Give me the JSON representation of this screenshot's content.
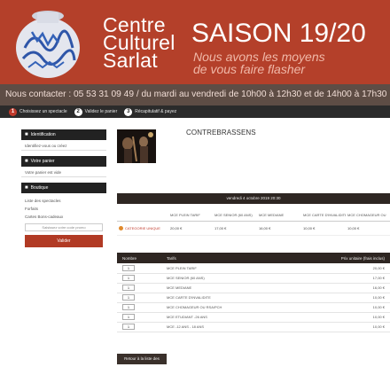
{
  "banner": {
    "brand_line1": "Centre",
    "brand_line2": "Culturel",
    "brand_line3": "Sarlat",
    "season": "SAISON 19/20",
    "tagline_line1": "Nous avons les moyens",
    "tagline_line2": "de vous faire flasher",
    "contact": "Nous contacter : 05 53 31 09 49 / du mardi au vendredi de 10h00 à 12h30 et de 14h00 à 17h30",
    "colors": {
      "banner": "#b4402a",
      "contact_bar": "#5e4d45"
    }
  },
  "steps": [
    {
      "num": "1",
      "label": "Choisissez un spectacle"
    },
    {
      "num": "2",
      "label": "Validez le panier"
    },
    {
      "num": "3",
      "label": "Récapitulatif & payez"
    }
  ],
  "sidebar": {
    "identification": {
      "icon": "user-icon",
      "title": "Identification",
      "link": "Identifiez-vous ou créez"
    },
    "panier": {
      "icon": "cart-icon",
      "title": "Votre panier",
      "link": "Votre panier est vide"
    },
    "boutique": {
      "icon": "tag-icon",
      "title": "Boutique",
      "items": [
        "Liste des spectacles",
        "Forfaits",
        "Cartes Bons-cadeaux"
      ]
    },
    "code_placeholder": "Saisissez votre code promo",
    "validate_label": "Valider"
  },
  "event": {
    "title": "CONTREBRASSENS",
    "date": "vendredi 4 octobre 2019 20:30"
  },
  "prices": {
    "headers": [
      "",
      "MCE PLEIN TARIF",
      "MCE SENIOR (60 ANS)",
      "MCE MEDIANE",
      "MCE CARTE D'INVALIDITE",
      "MCE CHOMAGEUR OU"
    ],
    "row": {
      "category": "CATEGORIE UNIQUE",
      "values": [
        "20,00 €",
        "17,00 €",
        "16,00 €",
        "10,00 €",
        "10,00 €"
      ]
    }
  },
  "tariffs": {
    "headers": [
      "Nombre",
      "Tarifs",
      "Prix unitaire (frais inclus)"
    ],
    "rows": [
      {
        "qty": "1",
        "name": "MCE PLEIN TARIF",
        "price": "20,00 €"
      },
      {
        "qty": "1",
        "name": "MCE SENIOR (60 ANS)",
        "price": "17,00 €"
      },
      {
        "qty": "1",
        "name": "MCE MEDIANE",
        "price": "16,00 €"
      },
      {
        "qty": "1",
        "name": "MCE CARTE D'INVALIDITE",
        "price": "10,00 €"
      },
      {
        "qty": "1",
        "name": "MCE CHOMAGEUR OU RSA/PCH",
        "price": "10,00 €"
      },
      {
        "qty": "1",
        "name": "MCE ETUDIANT -26 ANS",
        "price": "10,00 €"
      },
      {
        "qty": "1",
        "name": "MCE -12 ANS - 18 ANS",
        "price": "10,00 €"
      }
    ]
  },
  "back_label": "Retour à la liste des manifestations"
}
